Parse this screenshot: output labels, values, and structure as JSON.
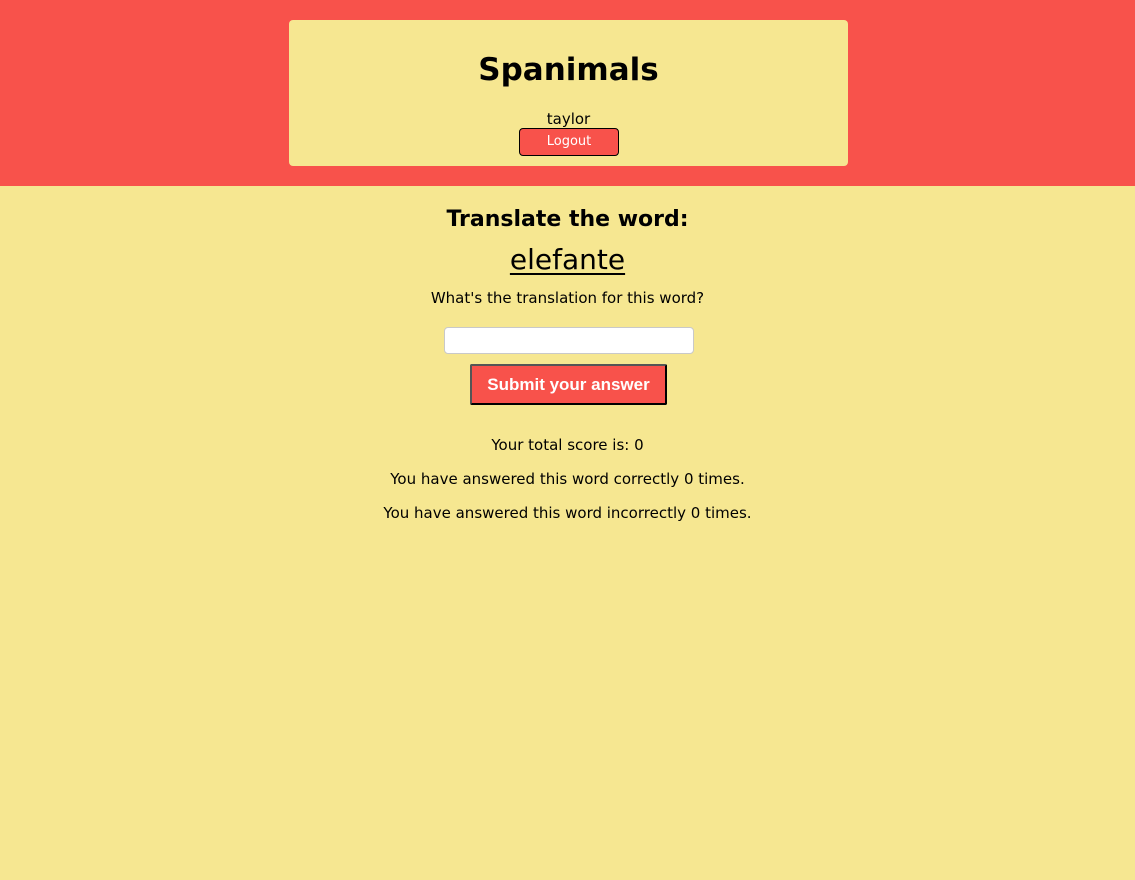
{
  "header": {
    "title": "Spanimals",
    "username": "taylor",
    "logout_label": "Logout"
  },
  "quiz": {
    "heading": "Translate the word:",
    "word": "elefante",
    "instruction": "What's the translation for this word?",
    "answer_value": "",
    "submit_label": "Submit your answer"
  },
  "stats": {
    "total_score_text": "Your total score is: 0",
    "correct_text": "You have answered this word correctly 0 times.",
    "incorrect_text": "You have answered this word incorrectly 0 times."
  },
  "colors": {
    "brand_red": "#f8524b",
    "background_yellow": "#f6e791"
  }
}
